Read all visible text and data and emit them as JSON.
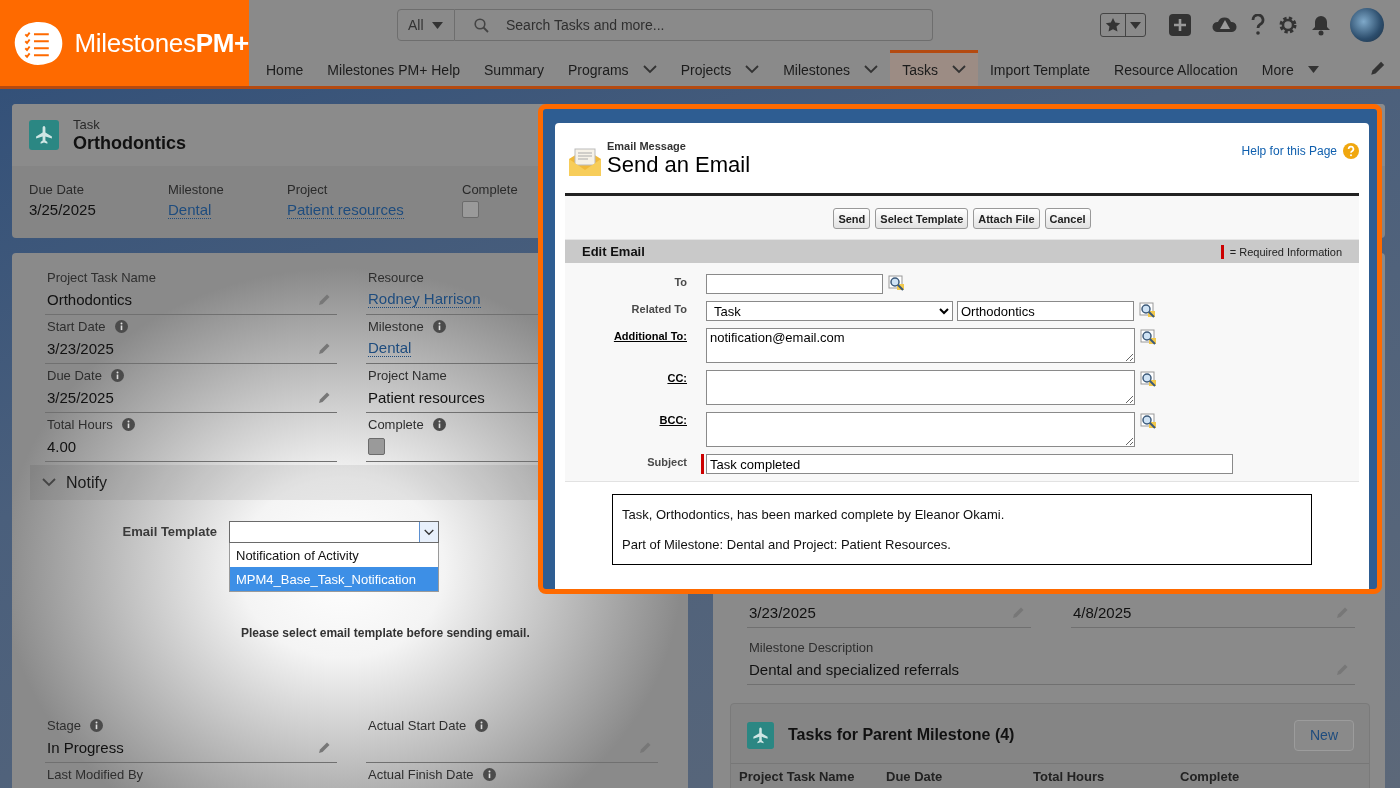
{
  "header": {
    "logo": "Milestones**PM+**",
    "search": {
      "scope": "All",
      "placeholder": "Search Tasks and more..."
    },
    "nav": [
      {
        "label": "Home",
        "kind": "link",
        "selected": false
      },
      {
        "label": "Milestones PM+ Help",
        "kind": "link",
        "selected": false
      },
      {
        "label": "Summary",
        "kind": "link",
        "selected": false
      },
      {
        "label": "Programs",
        "kind": "menu",
        "selected": false
      },
      {
        "label": "Projects",
        "kind": "menu",
        "selected": false
      },
      {
        "label": "Milestones",
        "kind": "menu",
        "selected": false
      },
      {
        "label": "Tasks",
        "kind": "menu",
        "selected": true
      },
      {
        "label": "Import Template",
        "kind": "link",
        "selected": false
      },
      {
        "label": "Resource Allocation",
        "kind": "link",
        "selected": false
      },
      {
        "label": "More",
        "kind": "overflow",
        "selected": false
      }
    ]
  },
  "record": {
    "type": "Task",
    "title": "Orthodontics",
    "highlights": [
      {
        "label": "Due Date",
        "kind": "text",
        "value": "3/25/2025"
      },
      {
        "label": "Milestone",
        "kind": "link",
        "value": "Dental"
      },
      {
        "label": "Project",
        "kind": "link",
        "value": "Patient resources"
      },
      {
        "label": "Complete",
        "kind": "checkbox",
        "checked": false
      }
    ]
  },
  "details": {
    "fields": [
      {
        "label": "Project Task Name",
        "kind": "text",
        "value": "Orthodontics",
        "info": false,
        "editable": true
      },
      {
        "label": "Resource",
        "kind": "link",
        "value": "Rodney Harrison",
        "info": false,
        "editable": false
      },
      {
        "label": "Start Date",
        "kind": "text",
        "value": "3/23/2025",
        "info": true,
        "editable": true
      },
      {
        "label": "Milestone",
        "kind": "link",
        "value": "Dental",
        "info": true,
        "editable": false
      },
      {
        "label": "Due Date",
        "kind": "text",
        "value": "3/25/2025",
        "info": true,
        "editable": true
      },
      {
        "label": "Project Name",
        "kind": "text",
        "value": "Patient resources",
        "info": false,
        "editable": false
      },
      {
        "label": "Total Hours",
        "kind": "text",
        "value": "4.00",
        "info": true,
        "editable": false
      },
      {
        "label": "Complete",
        "kind": "checkbox",
        "checked": false,
        "info": true,
        "editable": false
      }
    ],
    "notify": {
      "title": "Notify",
      "expanded": true,
      "template_label": "Email Template",
      "options": [
        {
          "label": "Notification of Activity",
          "selected": false
        },
        {
          "label": "MPM4_Base_Task_Notification",
          "selected": true
        }
      ],
      "hint": "Please select email template before sending email."
    },
    "more_fields": [
      {
        "label": "Stage",
        "kind": "text",
        "value": "In Progress",
        "info": true,
        "editable": true
      },
      {
        "label": "Actual Start Date",
        "kind": "text",
        "info": true,
        "editable": true
      },
      {
        "label": "Last Modified By",
        "kind": "text",
        "info": false,
        "editable": false
      },
      {
        "label": "Actual Finish Date",
        "kind": "text",
        "info": true,
        "editable": false
      }
    ]
  },
  "milestone": {
    "dates": [
      {
        "value": "3/23/2025",
        "editable": true
      },
      {
        "value": "4/8/2025",
        "editable": true
      }
    ],
    "description": {
      "label": "Milestone Description",
      "value": "Dental and specialized referrals",
      "editable": true
    },
    "related": {
      "title": "Tasks for Parent Milestone (4)",
      "button": "New",
      "columns": [
        "Project Task Name",
        "Due Date",
        "Total Hours",
        "Complete"
      ]
    }
  },
  "email": {
    "subtitle": "Email Message",
    "title": "Send an Email",
    "help": "Help for this Page",
    "buttons": [
      "Send",
      "Select Template",
      "Attach File",
      "Cancel"
    ],
    "section": "Edit Email",
    "required_note": "= Required Information",
    "fields": [
      {
        "label": "To",
        "kind": "input",
        "underlined": false,
        "required": false,
        "lookup": true
      },
      {
        "label": "Related To",
        "kind": "related",
        "type_value": "Task",
        "value": "Orthodontics",
        "underlined": false,
        "required": false,
        "lookup": true
      },
      {
        "label": "Additional To:",
        "kind": "textarea",
        "value": "notification@email.com",
        "underlined": true,
        "required": false,
        "lookup": true
      },
      {
        "label": "CC:",
        "kind": "textarea",
        "underlined": true,
        "required": false,
        "lookup": true
      },
      {
        "label": "BCC:",
        "kind": "textarea",
        "underlined": true,
        "required": false,
        "lookup": true
      },
      {
        "label": "Subject",
        "kind": "input",
        "value": "Task completed",
        "underlined": false,
        "required": true,
        "lookup": false
      }
    ],
    "body": [
      "Task, Orthodontics, has been marked complete by Eleanor Okami.",
      "Part of Milestone: Dental and Project: Patient Resources."
    ]
  }
}
